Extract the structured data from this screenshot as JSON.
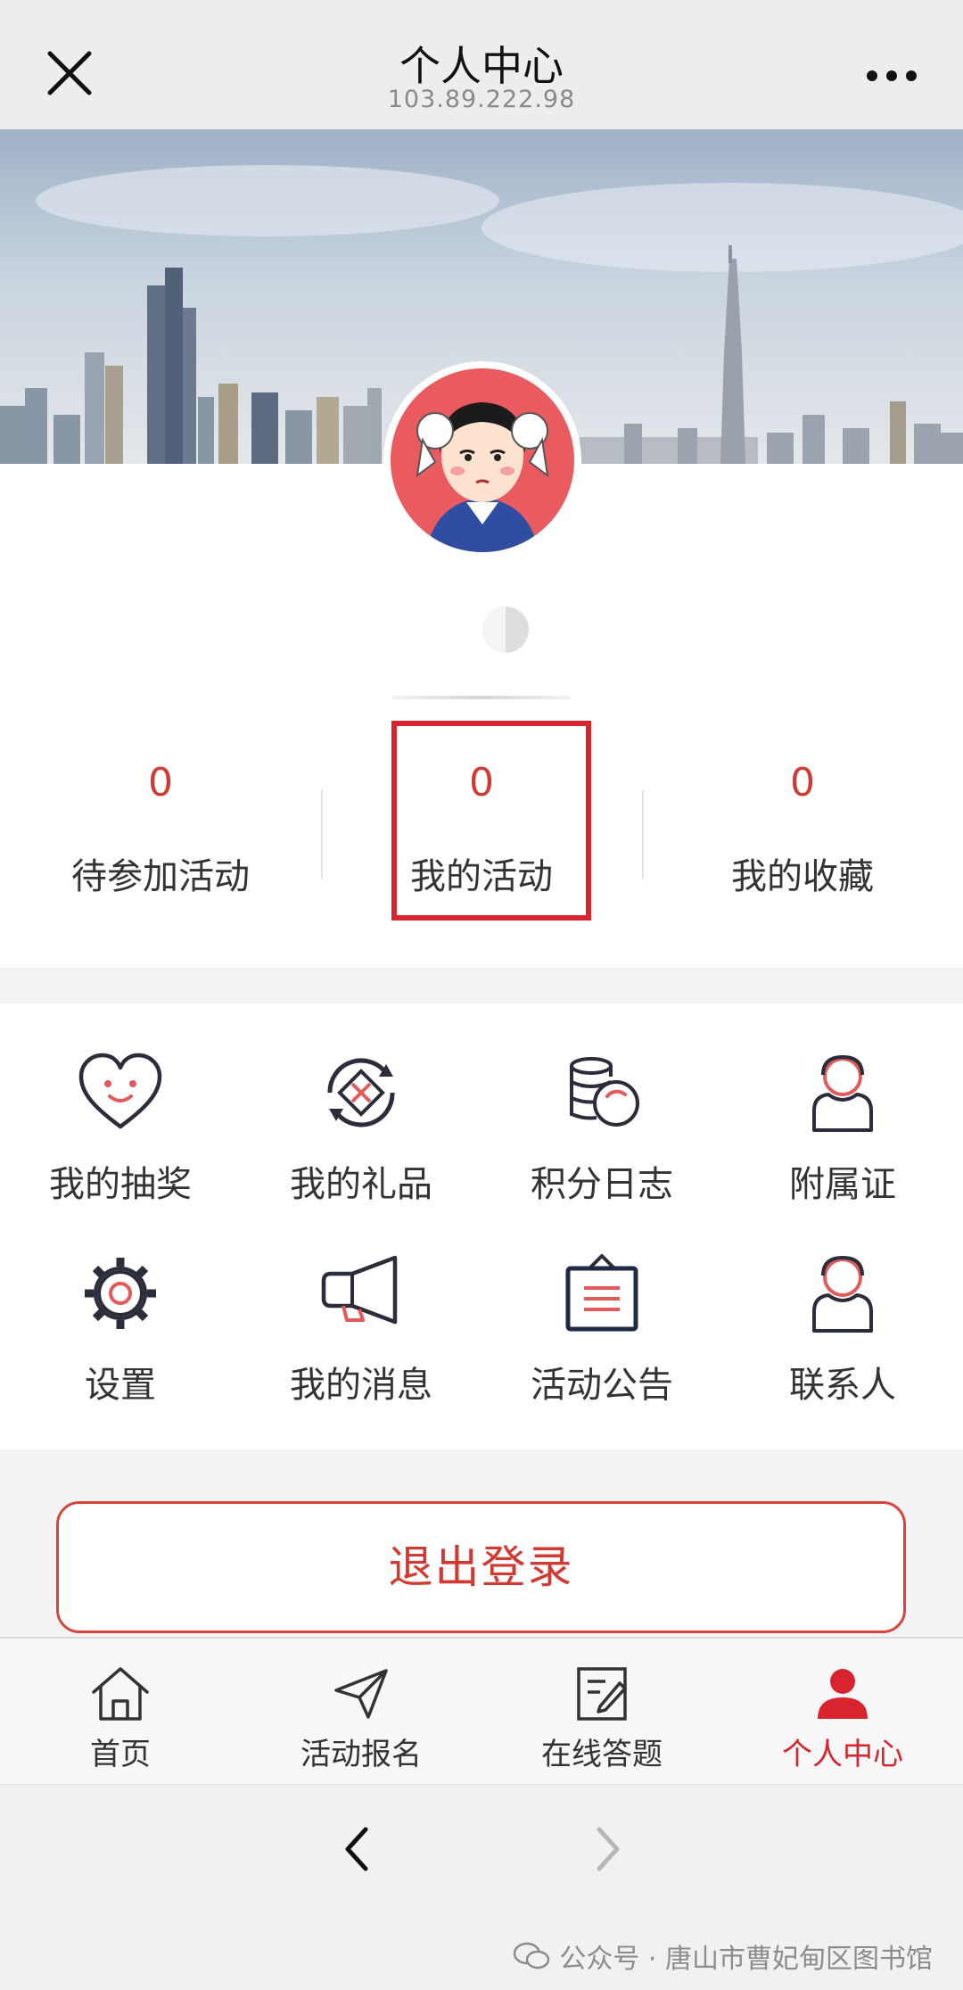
{
  "header": {
    "title": "个人中心",
    "subtitle": "103.89.222.98"
  },
  "stats": [
    {
      "value": "0",
      "label": "待参加活动"
    },
    {
      "value": "0",
      "label": "我的活动"
    },
    {
      "value": "0",
      "label": "我的收藏"
    }
  ],
  "grid": [
    {
      "label": "我的抽奖",
      "icon": "heart-face-icon"
    },
    {
      "label": "我的礼品",
      "icon": "gift-coin-icon"
    },
    {
      "label": "积分日志",
      "icon": "coins-stack-icon"
    },
    {
      "label": "附属证",
      "icon": "person-card-icon"
    },
    {
      "label": "设置",
      "icon": "gear-icon"
    },
    {
      "label": "我的消息",
      "icon": "megaphone-icon"
    },
    {
      "label": "活动公告",
      "icon": "notice-board-icon"
    },
    {
      "label": "联系人",
      "icon": "contact-person-icon"
    }
  ],
  "logout": {
    "label": "退出登录"
  },
  "nav": [
    {
      "label": "首页",
      "icon": "home-icon"
    },
    {
      "label": "活动报名",
      "icon": "send-arrow-icon"
    },
    {
      "label": "在线答题",
      "icon": "edit-note-icon"
    },
    {
      "label": "个人中心",
      "icon": "user-icon",
      "active": true
    }
  ],
  "watermark": {
    "text": "公众号 · 唐山市曹妃甸区图书馆"
  },
  "colors": {
    "accent": "#d8242e",
    "stat_number": "#d03a32",
    "avatar_bg": "#e95b5f"
  }
}
